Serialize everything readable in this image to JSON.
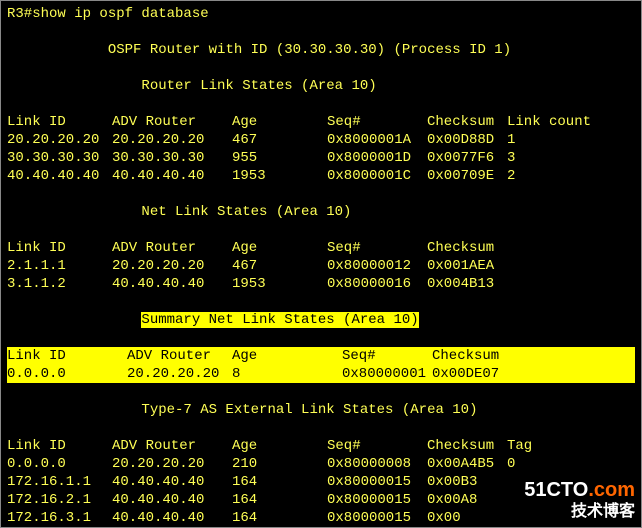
{
  "prompt": "R3#show ip ospf database",
  "header": "OSPF Router with ID (30.30.30.30) (Process ID 1)",
  "sections": {
    "router": {
      "title": "Router Link States (Area 10)",
      "cols": {
        "link": "Link ID",
        "adv": "ADV Router",
        "age": "Age",
        "seq": "Seq#",
        "chk": "Checksum",
        "extra": "Link count"
      },
      "rows": [
        {
          "link": "20.20.20.20",
          "adv": "20.20.20.20",
          "age": "467",
          "seq": "0x8000001A",
          "chk": "0x00D88D",
          "extra": "1"
        },
        {
          "link": "30.30.30.30",
          "adv": "30.30.30.30",
          "age": "955",
          "seq": "0x8000001D",
          "chk": "0x0077F6",
          "extra": "3"
        },
        {
          "link": "40.40.40.40",
          "adv": "40.40.40.40",
          "age": "1953",
          "seq": "0x8000001C",
          "chk": "0x00709E",
          "extra": "2"
        }
      ]
    },
    "net": {
      "title": "Net Link States (Area 10)",
      "cols": {
        "link": "Link ID",
        "adv": "ADV Router",
        "age": "Age",
        "seq": "Seq#",
        "chk": "Checksum"
      },
      "rows": [
        {
          "link": "2.1.1.1",
          "adv": "20.20.20.20",
          "age": "467",
          "seq": "0x80000012",
          "chk": "0x001AEA"
        },
        {
          "link": "3.1.1.2",
          "adv": "40.40.40.40",
          "age": "1953",
          "seq": "0x80000016",
          "chk": "0x004B13"
        }
      ]
    },
    "summary": {
      "title": "Summary Net Link States (Area 10)",
      "cols": {
        "link": "Link ID",
        "adv": "ADV Router",
        "age": "Age",
        "seq": "Seq#",
        "chk": "Checksum"
      },
      "rows": [
        {
          "link": "0.0.0.0",
          "adv": "20.20.20.20",
          "age": "8",
          "seq": "0x80000001",
          "chk": "0x00DE07"
        }
      ]
    },
    "type7": {
      "title": "Type-7 AS External Link States (Area 10)",
      "cols": {
        "link": "Link ID",
        "adv": "ADV Router",
        "age": "Age",
        "seq": "Seq#",
        "chk": "Checksum",
        "extra": "Tag"
      },
      "rows": [
        {
          "link": "0.0.0.0",
          "adv": "20.20.20.20",
          "age": "210",
          "seq": "0x80000008",
          "chk": "0x00A4B5",
          "extra": "0"
        },
        {
          "link": "172.16.1.1",
          "adv": "40.40.40.40",
          "age": "164",
          "seq": "0x80000015",
          "chk": "0x00B3",
          "extra": ""
        },
        {
          "link": "172.16.2.1",
          "adv": "40.40.40.40",
          "age": "164",
          "seq": "0x80000015",
          "chk": "0x00A8",
          "extra": ""
        },
        {
          "link": "172.16.3.1",
          "adv": "40.40.40.40",
          "age": "164",
          "seq": "0x80000015",
          "chk": "0x00",
          "extra": ""
        }
      ]
    }
  },
  "watermark": {
    "line1a": "51CTO",
    "line1b": ".com",
    "line2": "技术博客"
  }
}
